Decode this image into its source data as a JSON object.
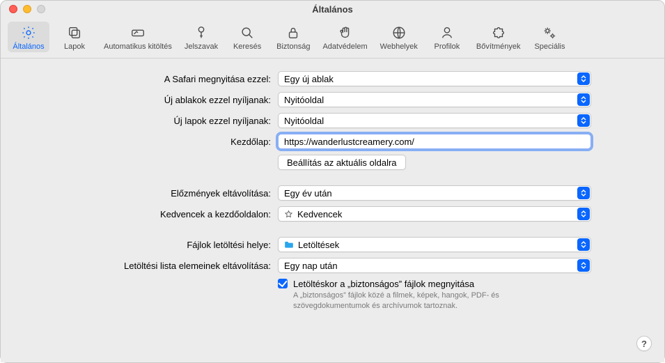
{
  "window": {
    "title": "Általános"
  },
  "toolbar": {
    "items": [
      {
        "label": "Általános"
      },
      {
        "label": "Lapok"
      },
      {
        "label": "Automatikus kitöltés"
      },
      {
        "label": "Jelszavak"
      },
      {
        "label": "Keresés"
      },
      {
        "label": "Biztonság"
      },
      {
        "label": "Adatvédelem"
      },
      {
        "label": "Webhelyek"
      },
      {
        "label": "Profilok"
      },
      {
        "label": "Bővítmények"
      },
      {
        "label": "Speciális"
      }
    ]
  },
  "form": {
    "open_with_label": "A Safari megnyitása ezzel:",
    "open_with_value": "Egy új ablak",
    "new_windows_label": "Új ablakok ezzel nyíljanak:",
    "new_windows_value": "Nyitóoldal",
    "new_tabs_label": "Új lapok ezzel nyíljanak:",
    "new_tabs_value": "Nyitóoldal",
    "homepage_label": "Kezdőlap:",
    "homepage_value": "https://wanderlustcreamery.com/",
    "set_current_btn": "Beállítás az aktuális oldalra",
    "history_label": "Előzmények eltávolítása:",
    "history_value": "Egy év után",
    "favorites_label": "Kedvencek a kezdőoldalon:",
    "favorites_value": "Kedvencek",
    "downloads_label": "Fájlok letöltési helye:",
    "downloads_value": "Letöltések",
    "dl_list_label": "Letöltési lista elemeinek eltávolítása:",
    "dl_list_value": "Egy nap után",
    "open_safe_label": "Letöltéskor a „biztonságos” fájlok megnyitása",
    "open_safe_hint": "A „biztonságos” fájlok közé a filmek, képek, hangok, PDF- és szövegdokumentumok és archívumok tartoznak."
  },
  "help": {
    "glyph": "?"
  }
}
